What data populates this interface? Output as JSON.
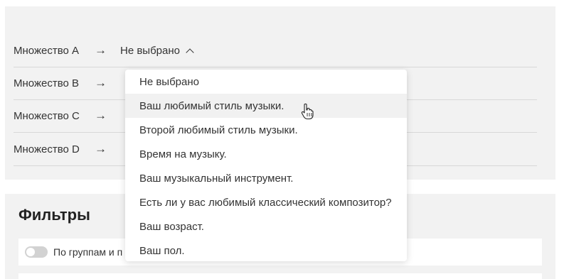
{
  "sets": [
    {
      "label": "Множество A",
      "arrow": "→",
      "value": "Не выбрано"
    },
    {
      "label": "Множество B",
      "arrow": "→"
    },
    {
      "label": "Множество C",
      "arrow": "→"
    },
    {
      "label": "Множество D",
      "arrow": "→"
    }
  ],
  "dropdown": {
    "options": [
      "Не выбрано",
      "Ваш любимый стиль музыки.",
      "Второй любимый стиль музыки.",
      "Время на музыку.",
      "Ваш музыкальный инструмент.",
      "Есть ли у вас любимый классический композитор?",
      "Ваш возраст.",
      "Ваш пол."
    ],
    "hovered_index": 1
  },
  "filters": {
    "title": "Фильтры",
    "toggle_label": "По группам и п",
    "toggle_on": false
  },
  "colors": {
    "panel_bg": "#f2f2f2",
    "hover_bg": "#f1f1f1",
    "toggle_off": "#d2d2d2"
  }
}
